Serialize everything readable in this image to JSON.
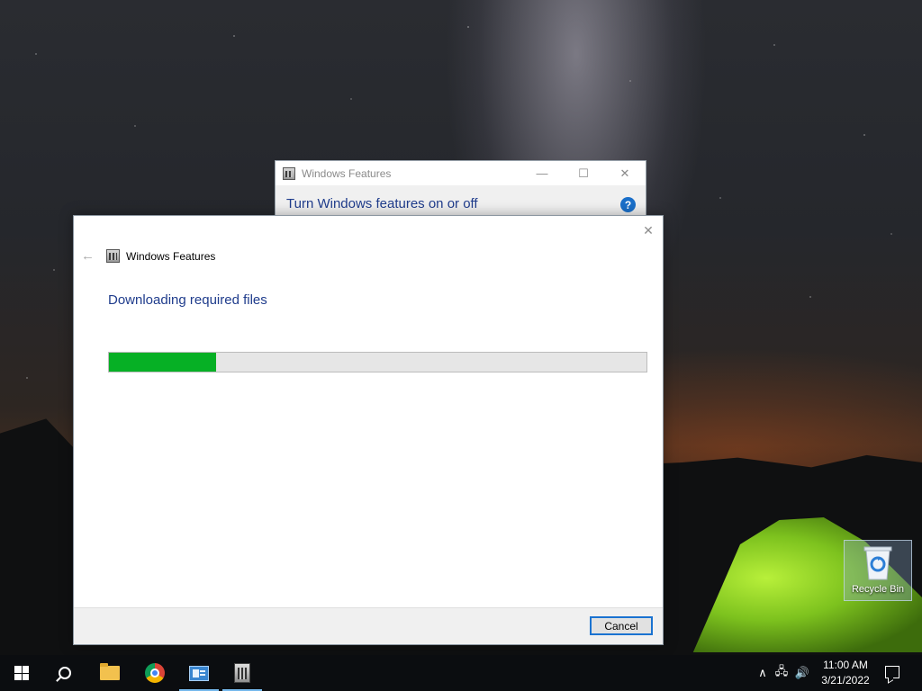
{
  "background_window": {
    "title": "Windows Features",
    "heading": "Turn Windows features on or off",
    "help_glyph": "?",
    "controls": {
      "minimize": "—",
      "maximize": "☐",
      "close": "✕"
    }
  },
  "dialog": {
    "title": "Windows Features",
    "heading": "Downloading required files",
    "progress_percent": 20,
    "progress_color": "#06b025",
    "cancel_label": "Cancel",
    "close_glyph": "✕",
    "back_glyph": "←"
  },
  "desktop": {
    "recycle_bin_label": "Recycle Bin"
  },
  "taskbar": {
    "apps": [
      "start-icon",
      "search-icon",
      "folder-icon",
      "chrome-icon",
      "server-manager-icon",
      "windows-features-icon"
    ],
    "tray": {
      "chevron": "∧",
      "network_glyph": "🖧",
      "volume_glyph": "🔊"
    },
    "clock": {
      "time": "11:00 AM",
      "date": "3/21/2022"
    }
  }
}
